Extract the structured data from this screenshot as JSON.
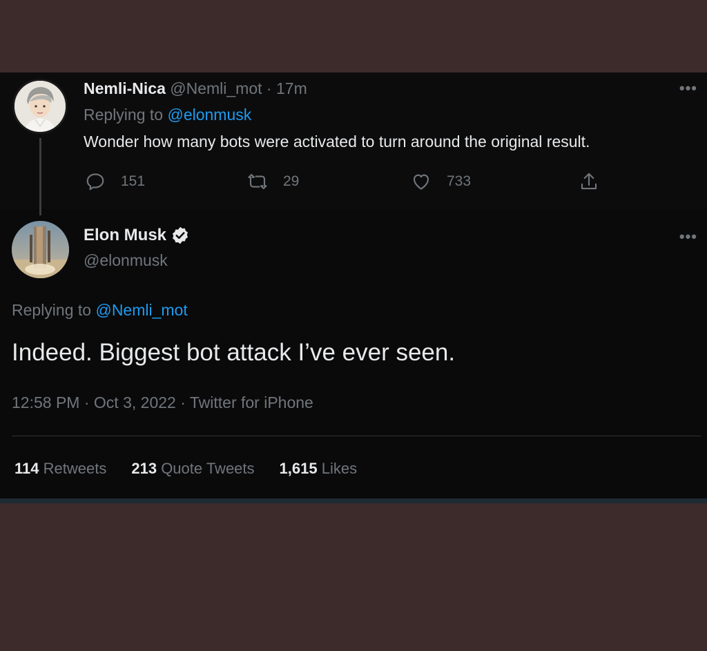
{
  "reply_tweet": {
    "display_name": "Nemli-Nica",
    "handle": "@Nemli_mot",
    "time": "17m",
    "replying_prefix": "Replying to",
    "replying_to": "@elonmusk",
    "text": "Wonder how many bots were activated to turn around the original result.",
    "replies": "151",
    "retweets": "29",
    "likes": "733"
  },
  "main_tweet": {
    "display_name": "Elon Musk",
    "handle": "@elonmusk",
    "replying_prefix": "Replying to",
    "replying_to": "@Nemli_mot",
    "text": "Indeed. Biggest bot attack I’ve ever seen.",
    "time": "12:58 PM",
    "date": "Oct 3, 2022",
    "client": "Twitter for iPhone",
    "stats": {
      "retweets": "114",
      "retweets_label": "Retweets",
      "quote_tweets": "213",
      "quote_tweets_label": "Quote Tweets",
      "likes": "1,615",
      "likes_label": "Likes"
    }
  },
  "colors": {
    "link": "#1d9bf0",
    "muted": "#71767b",
    "text": "#e7e9ea",
    "background": "#0a0a0b",
    "outer": "#3d2a2a"
  },
  "icons": [
    "more-icon",
    "reply-icon",
    "retweet-icon",
    "like-icon",
    "share-icon",
    "verified-badge-icon"
  ]
}
